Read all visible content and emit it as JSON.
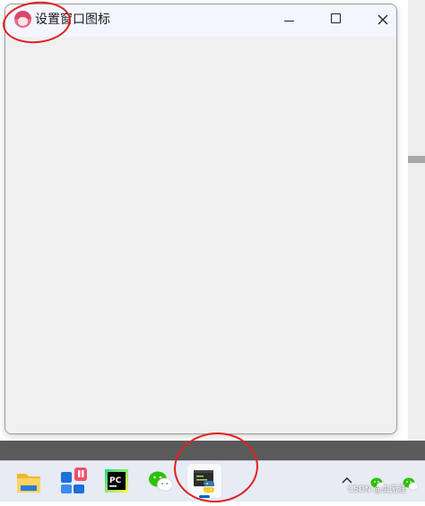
{
  "window": {
    "title": "设置窗口图标",
    "icon": "avatar-app-icon",
    "controls": [
      "minimize-icon",
      "maximize-icon",
      "close-icon"
    ]
  },
  "taskbar": {
    "apps": [
      {
        "name": "file-explorer",
        "icon": "folder-icon"
      },
      {
        "name": "widgets",
        "icon": "widgets-icon"
      },
      {
        "name": "pycharm",
        "icon": "pycharm-icon",
        "label": "PC"
      },
      {
        "name": "wechat",
        "icon": "wechat-icon"
      },
      {
        "name": "python",
        "icon": "python-icon",
        "active": true
      }
    ],
    "tray": [
      {
        "icon": "chevron-up-icon"
      },
      {
        "icon": "wechat-tray-icon"
      },
      {
        "icon": "wechat-tray-icon-2"
      }
    ]
  },
  "watermark": "CSDN @虫无涯",
  "colors": {
    "annotation": "#e0201e",
    "titlebar": "#f3f5ff",
    "client": "#f0f0f0",
    "taskbar": "#e6ebf4"
  }
}
